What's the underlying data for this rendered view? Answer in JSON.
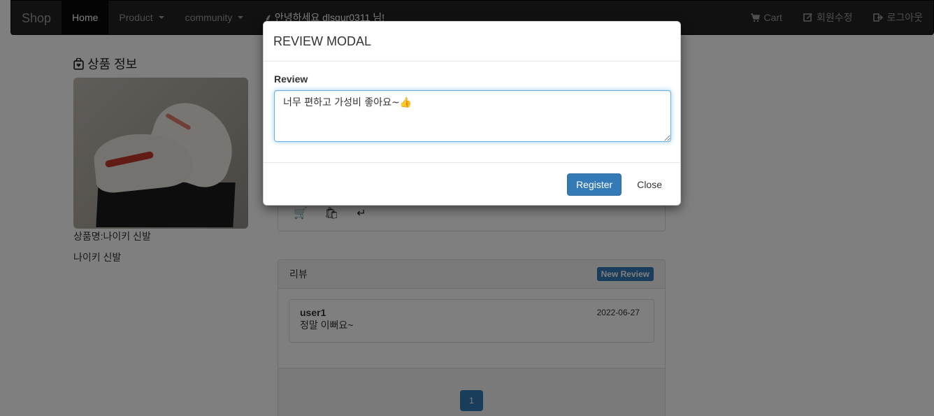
{
  "navbar": {
    "brand": "Shop",
    "home": "Home",
    "product": "Product",
    "community": "community",
    "greeting": "안녕하세요 dlsgur0311 님!",
    "cart": "Cart",
    "edit_member": "회원수정",
    "logout": "로그아웃"
  },
  "product": {
    "section_title": "상품 정보",
    "name_line": "상품명:나이키 신발",
    "description": "나이키 신발"
  },
  "reviews": {
    "header": "리뷰",
    "new_review_label": "New Review",
    "items": [
      {
        "user": "user1",
        "date": "2022-06-27",
        "content": "정말 이뻐요~"
      }
    ],
    "current_page": "1"
  },
  "modal": {
    "title": "REVIEW MODAL",
    "label": "Review",
    "textarea_value": "너무 편하고 가성비 좋아요~👍",
    "register_label": "Register",
    "close_label": "Close"
  },
  "colors": {
    "navbar_bg": "#222222",
    "primary": "#337ab7",
    "backdrop": "rgba(0,0,0,0.5)"
  },
  "icons": [
    "cart-icon",
    "edit-icon",
    "logout-icon",
    "bag-icon",
    "back-arrow-icon",
    "leaf-icon"
  ]
}
